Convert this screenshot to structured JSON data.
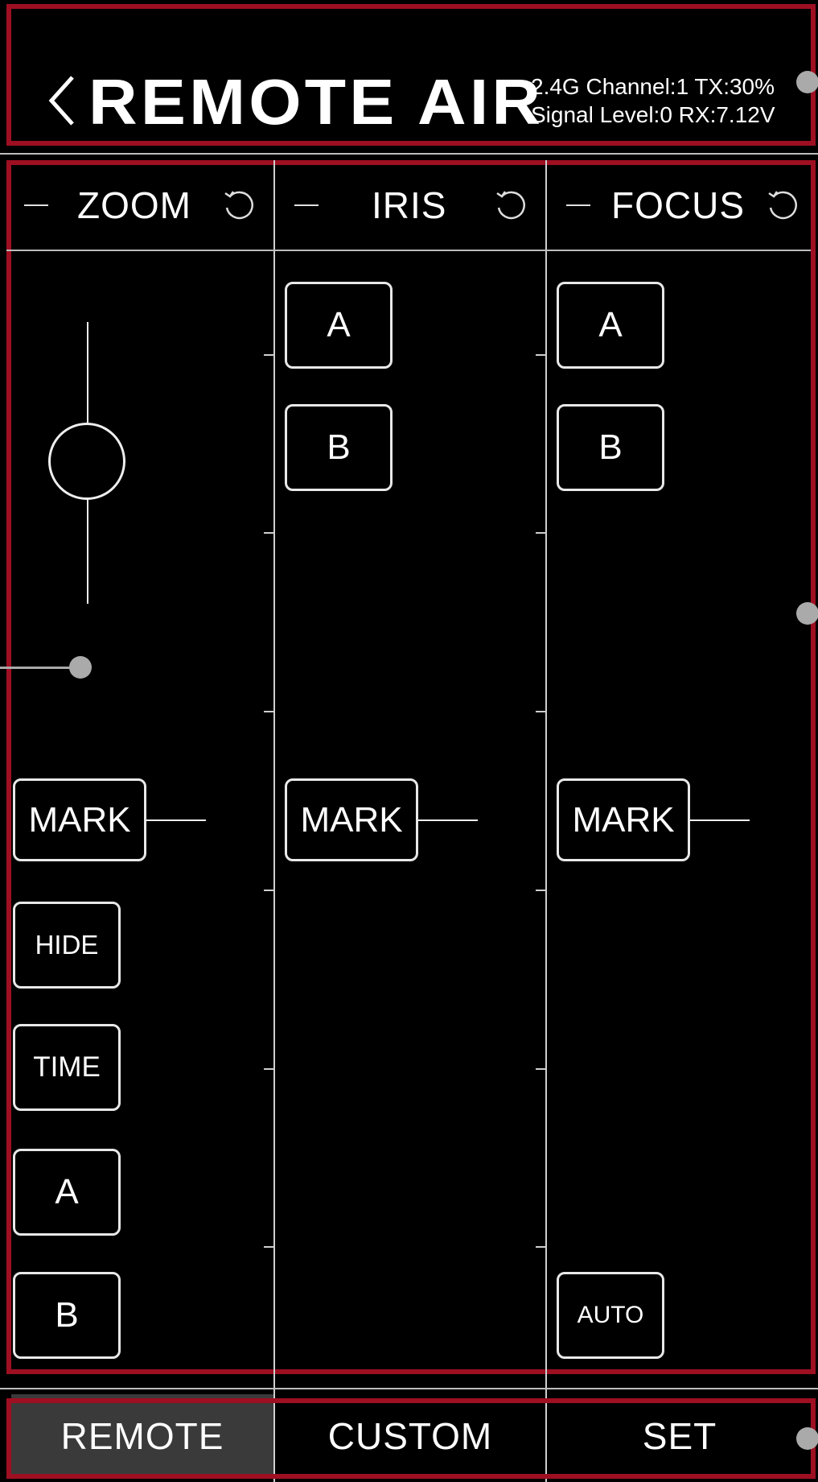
{
  "header": {
    "title": "REMOTE AIR",
    "status_line1": "2.4G Channel:1 TX:30%",
    "status_line2": "Signal Level:0 RX:7.12V"
  },
  "columns": [
    {
      "label": "ZOOM"
    },
    {
      "label": "IRIS"
    },
    {
      "label": "FOCUS"
    }
  ],
  "zoom": {
    "mark": "MARK",
    "hide": "HIDE",
    "time": "TIME",
    "a": "A",
    "b": "B"
  },
  "iris": {
    "a": "A",
    "b": "B",
    "mark": "MARK"
  },
  "focus": {
    "a": "A",
    "b": "B",
    "mark": "MARK",
    "auto": "AUTO"
  },
  "tabs": [
    {
      "label": "REMOTE",
      "active": true
    },
    {
      "label": "CUSTOM",
      "active": false
    },
    {
      "label": "SET",
      "active": false
    }
  ],
  "colors": {
    "frame": "#9e0f22",
    "active_tab_bg": "#3a3a3a"
  },
  "icons": {
    "back": "chevron-left-icon",
    "reset": "reset-icon",
    "minus": "minus-icon"
  }
}
